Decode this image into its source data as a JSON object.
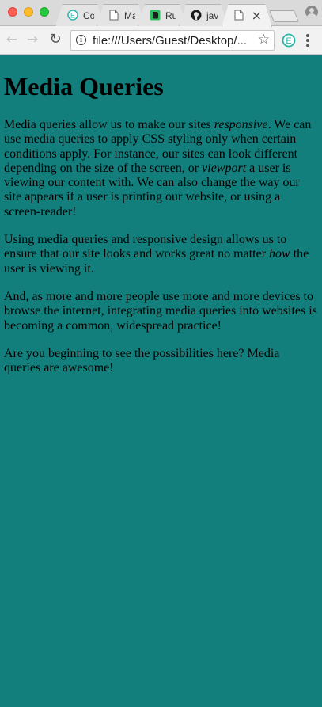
{
  "browser": {
    "tabs": [
      {
        "title": "Co",
        "icon": "evernote-web-clipper-icon"
      },
      {
        "title": "Ma",
        "icon": "page-icon"
      },
      {
        "title": "Ru",
        "icon": "evernote-icon"
      },
      {
        "title": "jav",
        "icon": "github-icon"
      },
      {
        "title": "",
        "icon": "page-icon",
        "active": true
      }
    ],
    "url": "file:///Users/Guest/Desktop/..."
  },
  "colors": {
    "page_background": "#137f7c"
  },
  "page": {
    "title": "Media Queries",
    "p1": {
      "t1": "Media queries allow us to make our sites ",
      "em1": "responsive",
      "t2": ". We can use media queries to apply CSS styling only when certain conditions apply. For instance, our sites can look different depending on the size of the screen, or ",
      "em2": "viewport",
      "t3": " a user is viewing our content with. We can also change the way our site appears if a user is printing our website, or using a screen-reader!"
    },
    "p2": {
      "t1": "Using media queries and responsive design allows us to ensure that our site looks and works great no matter ",
      "em1": "how",
      "t2": " the user is viewing it."
    },
    "p3": "And, as more and more people use more and more devices to browse the internet, integrating media queries into websites is becoming a common, widespread practice!",
    "p4": "Are you beginning to see the possibilities here? Media queries are awesome!"
  }
}
